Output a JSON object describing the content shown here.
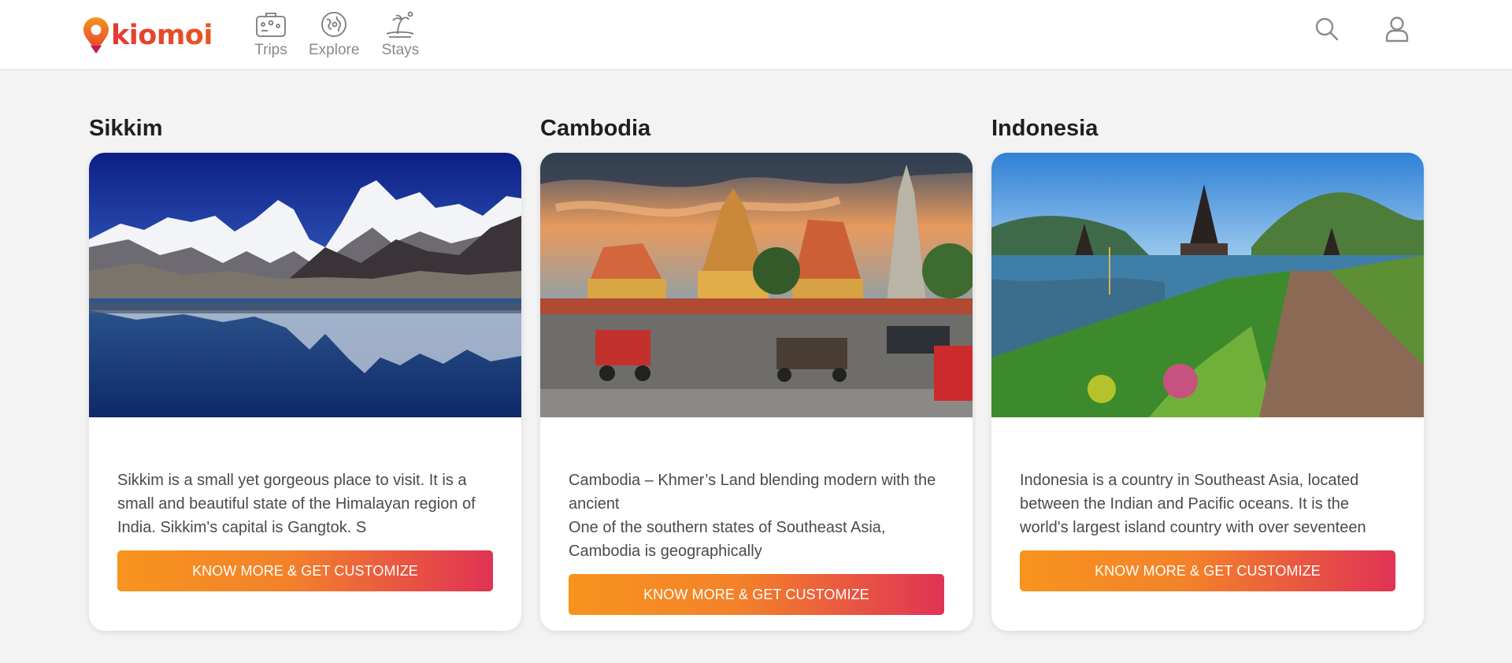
{
  "brand": {
    "name": "kiomoi"
  },
  "nav": [
    {
      "label": "Trips",
      "icon": "suitcase-icon"
    },
    {
      "label": "Explore",
      "icon": "globe-icon"
    },
    {
      "label": "Stays",
      "icon": "island-icon"
    }
  ],
  "header_actions": [
    "search-icon",
    "user-icon"
  ],
  "destinations": [
    {
      "title": "Sikkim",
      "description": [
        "Sikkim is a small yet gorgeous place to visit. It is a small and beautiful state of the Himalayan region of India. Sikkim's capital is Gangtok. S"
      ],
      "cta_label": "KNOW MORE & GET CUSTOMIZE"
    },
    {
      "title": "Cambodia",
      "description": [
        "Cambodia – Khmer’s Land blending modern with the ancient",
        "One of the southern states of Southeast Asia, Cambodia is geographically"
      ],
      "cta_label": "KNOW MORE & GET CUSTOMIZE"
    },
    {
      "title": "Indonesia",
      "description": [
        "Indonesia is a country in Southeast Asia, located between the Indian and Pacific oceans. It is the world's largest island country with over seventeen"
      ],
      "cta_label": "KNOW MORE & GET CUSTOMIZE"
    }
  ],
  "colors": {
    "accent_start": "#f7941d",
    "accent_end": "#e03354",
    "brand": "#e53935"
  }
}
